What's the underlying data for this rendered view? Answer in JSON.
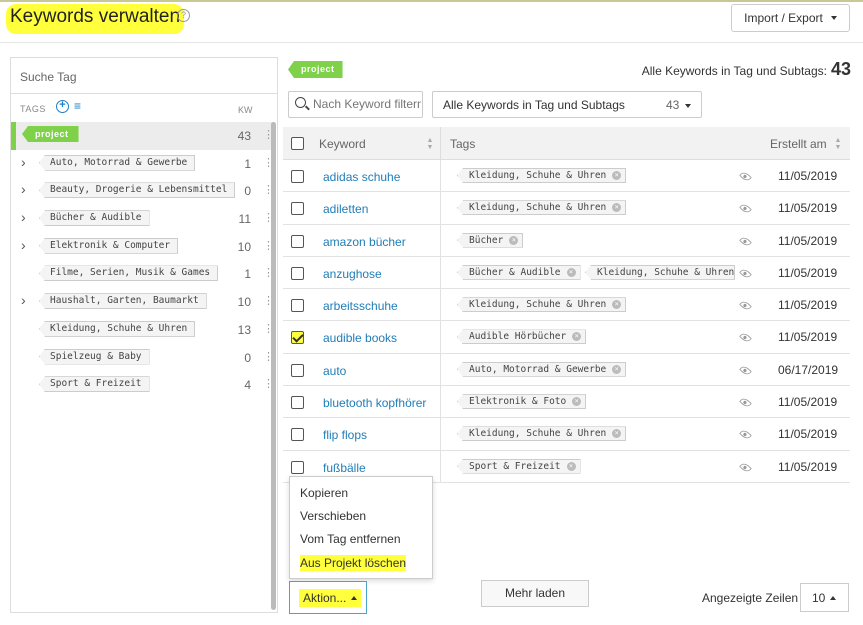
{
  "header": {
    "title": "Keywords verwalten",
    "help_icon": "?",
    "import_export_label": "Import / Export"
  },
  "sidebar": {
    "search_placeholder": "Suche Tag",
    "tags_label": "TAGS",
    "kw_label": "KW",
    "add_icon": "+",
    "list_icon": "≡",
    "root": {
      "label": "project",
      "count": "43"
    },
    "tags": [
      {
        "label": "Auto, Motorrad & Gewerbe",
        "count": "1",
        "has_children": true
      },
      {
        "label": "Beauty, Drogerie & Lebensmittel",
        "count": "0",
        "has_children": true
      },
      {
        "label": "Bücher & Audible",
        "count": "11",
        "has_children": true
      },
      {
        "label": "Elektronik & Computer",
        "count": "10",
        "has_children": true
      },
      {
        "label": "Filme, Serien, Musik & Games",
        "count": "1",
        "has_children": false
      },
      {
        "label": "Haushalt, Garten, Baumarkt",
        "count": "10",
        "has_children": true
      },
      {
        "label": "Kleidung, Schuhe & Uhren",
        "count": "13",
        "has_children": false
      },
      {
        "label": "Spielzeug & Baby",
        "count": "0",
        "has_children": false
      },
      {
        "label": "Sport & Freizeit",
        "count": "4",
        "has_children": false
      }
    ]
  },
  "main": {
    "project_badge": "project",
    "total_label": "Alle Keywords in Tag und Subtags:",
    "total_count": "43",
    "search_placeholder": "Nach Keyword filtern",
    "scope_label": "Alle Keywords in Tag und Subtags",
    "scope_count": "43",
    "columns": {
      "keyword": "Keyword",
      "tags": "Tags",
      "created": "Erstellt am"
    },
    "rows": [
      {
        "keyword": "adidas schuhe",
        "tags": [
          "Kleidung, Schuhe & Uhren"
        ],
        "date": "11/05/2019",
        "checked": false
      },
      {
        "keyword": "adiletten",
        "tags": [
          "Kleidung, Schuhe & Uhren"
        ],
        "date": "11/05/2019",
        "checked": false
      },
      {
        "keyword": "amazon bücher",
        "tags": [
          "Bücher"
        ],
        "date": "11/05/2019",
        "checked": false
      },
      {
        "keyword": "anzughose",
        "tags": [
          "Bücher & Audible",
          "Kleidung, Schuhe & Uhren"
        ],
        "date": "11/05/2019",
        "checked": false
      },
      {
        "keyword": "arbeitsschuhe",
        "tags": [
          "Kleidung, Schuhe & Uhren"
        ],
        "date": "11/05/2019",
        "checked": false
      },
      {
        "keyword": "audible books",
        "tags": [
          "Audible Hörbücher"
        ],
        "date": "11/05/2019",
        "checked": true
      },
      {
        "keyword": "auto",
        "tags": [
          "Auto, Motorrad & Gewerbe"
        ],
        "date": "06/17/2019",
        "checked": false
      },
      {
        "keyword": "bluetooth kopfhörer",
        "tags": [
          "Elektronik & Foto"
        ],
        "date": "11/05/2019",
        "checked": false
      },
      {
        "keyword": "flip flops",
        "tags": [
          "Kleidung, Schuhe & Uhren"
        ],
        "date": "11/05/2019",
        "checked": false
      },
      {
        "keyword": "fußbälle",
        "tags": [
          "Sport & Freizeit"
        ],
        "date": "11/05/2019",
        "checked": false
      }
    ]
  },
  "footer": {
    "action_menu": [
      "Kopieren",
      "Verschieben",
      "Vom Tag entfernen",
      "Aus Projekt löschen"
    ],
    "action_label": "Aktion...",
    "load_more_label": "Mehr laden",
    "rows_label": "Angezeigte Zeilen",
    "rows_value": "10"
  },
  "colors": {
    "accent_green": "#7fd14a",
    "link_blue": "#1f7db8",
    "highlight_yellow": "#ffff3c"
  }
}
